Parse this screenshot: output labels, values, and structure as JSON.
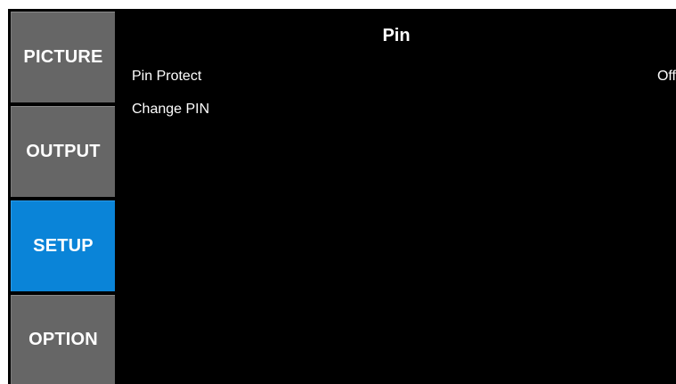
{
  "sidebar": {
    "items": [
      {
        "label": "PICTURE",
        "active": false
      },
      {
        "label": "OUTPUT",
        "active": false
      },
      {
        "label": "SETUP",
        "active": true
      },
      {
        "label": "OPTION",
        "active": false
      }
    ]
  },
  "panel": {
    "title": "Pin",
    "rows": [
      {
        "label": "Pin Protect",
        "value": "Off"
      },
      {
        "label": "Change PIN",
        "value": ""
      }
    ]
  },
  "colors": {
    "background": "#000000",
    "nav_inactive": "#666666",
    "nav_active": "#0a84d8",
    "text": "#ffffff"
  }
}
